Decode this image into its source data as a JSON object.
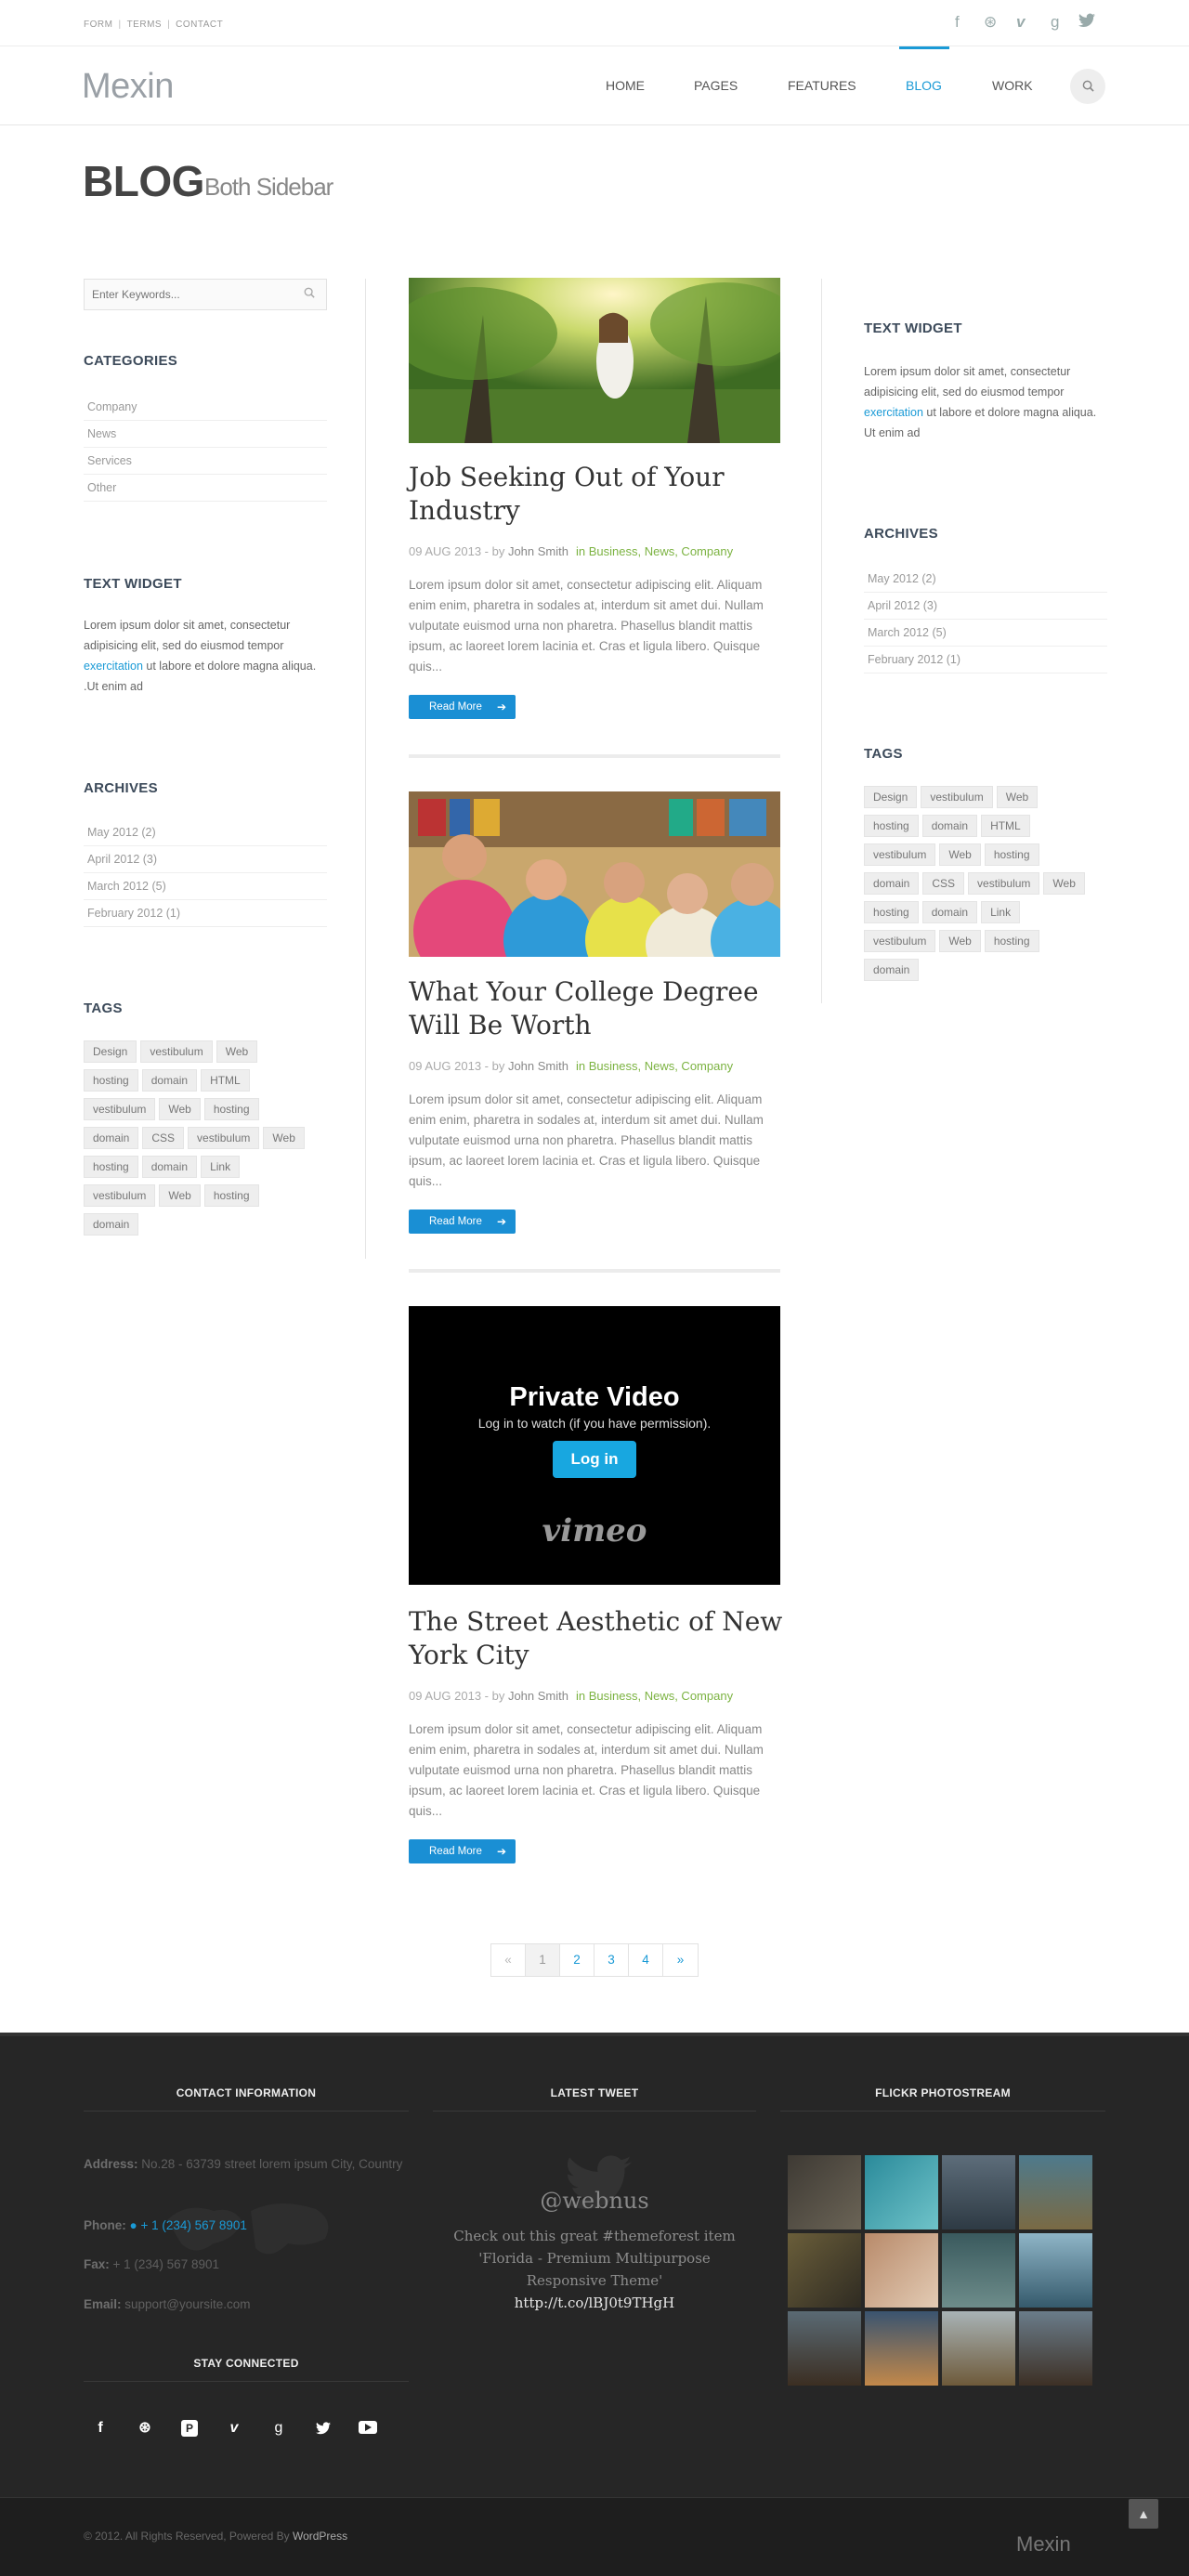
{
  "topbar": {
    "links": [
      "FORM",
      "TERMS",
      "CONTACT"
    ],
    "social_icons": [
      "facebook-icon",
      "dribbble-icon",
      "vimeo-icon",
      "google-plus-icon",
      "twitter-icon"
    ]
  },
  "header": {
    "logo": "Mexin",
    "nav": [
      "HOME",
      "PAGES",
      "FEATURES",
      "BLOG",
      "WORK"
    ],
    "active_nav": "BLOG",
    "search_icon": "search-icon"
  },
  "page": {
    "title": "BLOG",
    "subtitle": "Both Sidebar"
  },
  "left_sidebar": {
    "search_placeholder": "Enter Keywords...",
    "categories_title": "CATEGORIES",
    "categories": [
      "Company",
      "News",
      "Services",
      "Other"
    ],
    "text_widget_title": "TEXT WIDGET",
    "text_widget_1": "Lorem ipsum dolor sit amet, consectetur adipisicing elit, sed do eiusmod tempor",
    "text_widget_link": "exercitation",
    "text_widget_2": " ut labore et dolore magna aliqua. .Ut enim ad",
    "archives_title": "ARCHIVES",
    "archives": [
      "May 2012 (2)",
      "April 2012 (3)",
      "March 2012 (5)",
      "February 2012 (1)"
    ],
    "tags_title": "TAGS",
    "tags": [
      "Design",
      "vestibulum",
      "Web",
      "hosting",
      "domain",
      "HTML",
      "vestibulum",
      "Web",
      "hosting",
      "domain",
      "CSS",
      "vestibulum",
      "Web",
      "hosting",
      "domain",
      "Link",
      "vestibulum",
      "Web",
      "hosting",
      "domain"
    ]
  },
  "right_sidebar": {
    "text_widget_title": "TEXT WIDGET",
    "text_widget_1": "Lorem ipsum dolor sit amet, consectetur adipisicing elit, sed do eiusmod tempor",
    "text_widget_link": "exercitation",
    "text_widget_2": " ut labore et dolore magna aliqua. Ut enim ad",
    "archives_title": "ARCHIVES",
    "archives": [
      "May 2012 (2)",
      "April 2012 (3)",
      "March 2012 (5)",
      "February 2012 (1)"
    ],
    "tags_title": "TAGS",
    "tags": [
      "Design",
      "vestibulum",
      "Web",
      "hosting",
      "domain",
      "HTML",
      "vestibulum",
      "Web",
      "hosting",
      "domain",
      "CSS",
      "vestibulum",
      "Web",
      "hosting",
      "domain",
      "Link",
      "vestibulum",
      "Web",
      "hosting",
      "domain"
    ]
  },
  "posts": [
    {
      "title": "Job Seeking Out of Your Industry",
      "date": "09 AUG 2013 - by ",
      "author": "John Smith",
      "cats": "in Business, News, Company",
      "excerpt": "Lorem ipsum dolor sit amet, consectetur adipiscing elit. Aliquam enim enim, pharetra in sodales at, interdum sit amet dui. Nullam vulputate euismod urna non pharetra. Phasellus blandit mattis ipsum, ac laoreet lorem lacinia et. Cras et ligula libero. Quisque quis...",
      "read_more": "Read More"
    },
    {
      "title": "What Your College Degree Will Be Worth",
      "date": "09 AUG 2013 - by ",
      "author": "John Smith",
      "cats": "in Business, News, Company",
      "excerpt": "Lorem ipsum dolor sit amet, consectetur adipiscing elit. Aliquam enim enim, pharetra in sodales at, interdum sit amet dui. Nullam vulputate euismod urna non pharetra. Phasellus blandit mattis ipsum, ac laoreet lorem lacinia et. Cras et ligula libero. Quisque quis...",
      "read_more": "Read More"
    },
    {
      "title": "The Street Aesthetic of New York City",
      "date": "09 AUG 2013 - by ",
      "author": "John Smith",
      "cats": "in Business, News, Company",
      "excerpt": "Lorem ipsum dolor sit amet, consectetur adipiscing elit. Aliquam enim enim, pharetra in sodales at, interdum sit amet dui. Nullam vulputate euismod urna non pharetra. Phasellus blandit mattis ipsum, ac laoreet lorem lacinia et. Cras et ligula libero. Quisque quis...",
      "read_more": "Read More"
    }
  ],
  "video": {
    "title": "Private Video",
    "subtitle": "Log in to watch (if you have permission).",
    "button": "Log in",
    "logo": "vimeo"
  },
  "pagination": [
    "«",
    "1",
    "2",
    "3",
    "4",
    "»"
  ],
  "footer": {
    "contact_title": "CONTACT INFORMATION",
    "address_label": "Address:",
    "address": " No.28 - 63739 street lorem ipsum City, Country",
    "phone_label": "Phone:",
    "phone": "+ 1 (234) 567 8901",
    "fax_label": "Fax:",
    "fax": " + 1 (234) 567 8901",
    "email_label": "Email:",
    "email": " support@yoursite.com",
    "stay_title": "STAY CONNECTED",
    "social_icons": [
      "facebook-icon",
      "dribbble-icon",
      "pinterest-icon",
      "vimeo-icon",
      "google-plus-icon",
      "twitter-icon",
      "youtube-icon"
    ],
    "tweet_title": "LATEST TWEET",
    "tweet_handle": "@webnus",
    "tweet_text": "Check out this great #themeforest item 'Florida - Premium Multipurpose Responsive Theme'",
    "tweet_link": "http://t.co/lBJ0t9THgH",
    "flickr_title": "FLICKR PHOTOSTREAM",
    "copyright": "© 2012. All Rights Reserved, Powered By ",
    "powered": "WordPress",
    "logo": "Mexin"
  },
  "colors": {
    "accent": "#1a9ad6",
    "category_green": "#7cb342",
    "footer_bg": "#262626"
  }
}
